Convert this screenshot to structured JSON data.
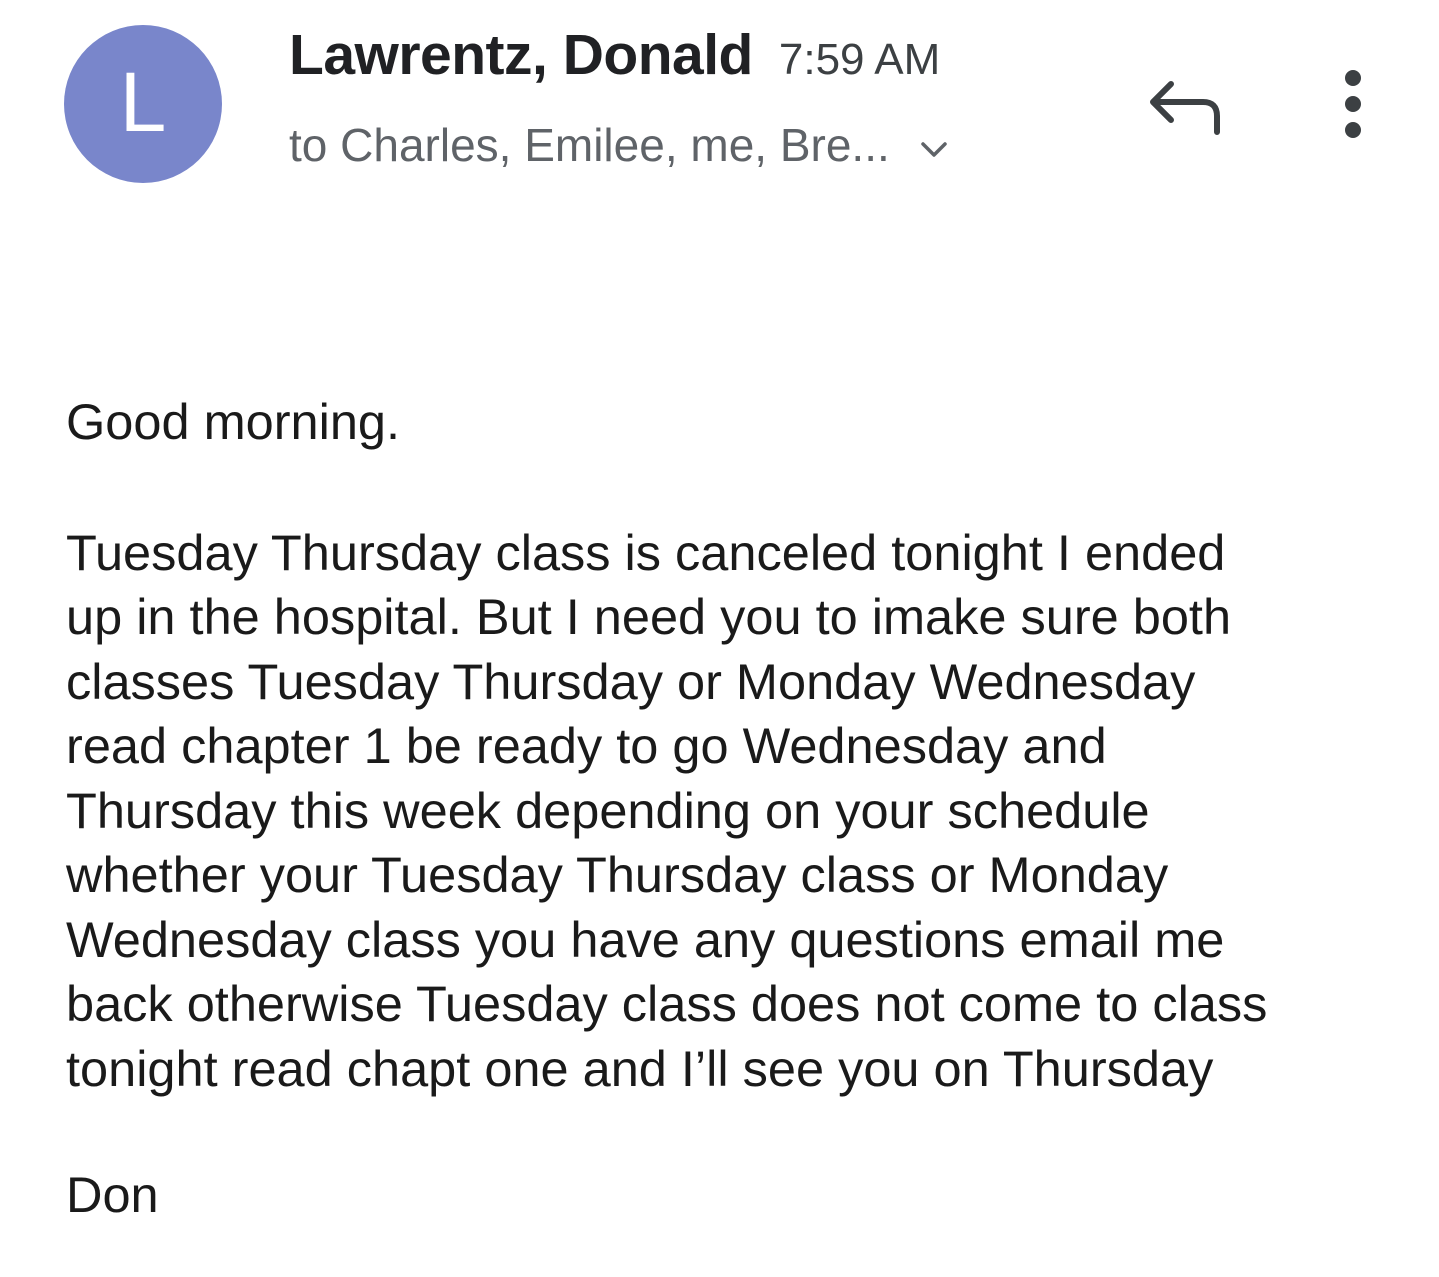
{
  "header": {
    "avatar_letter": "L",
    "avatar_color": "#7986cb",
    "sender_name": "Lawrentz, Donald",
    "time": "7:59 AM",
    "recipients": "to Charles, Emilee, me, Bre...",
    "expand_icon": "chevron-down-icon",
    "reply_icon": "reply-icon",
    "more_icon": "more-vert-icon"
  },
  "message": {
    "greeting": "Good morning.",
    "body": "Tuesday Thursday class is canceled tonight I ended\nup in the hospital. But I need you to imake sure both\nclasses Tuesday Thursday or Monday Wednesday\nread chapter 1 be ready to go Wednesday and\nThursday this week depending on your schedule\nwhether your Tuesday Thursday class or Monday\nWednesday class you have any questions email me\nback otherwise Tuesday class does not come to class\ntonight read chapt  one and I’ll see you on Thursday",
    "signature": "Don"
  }
}
